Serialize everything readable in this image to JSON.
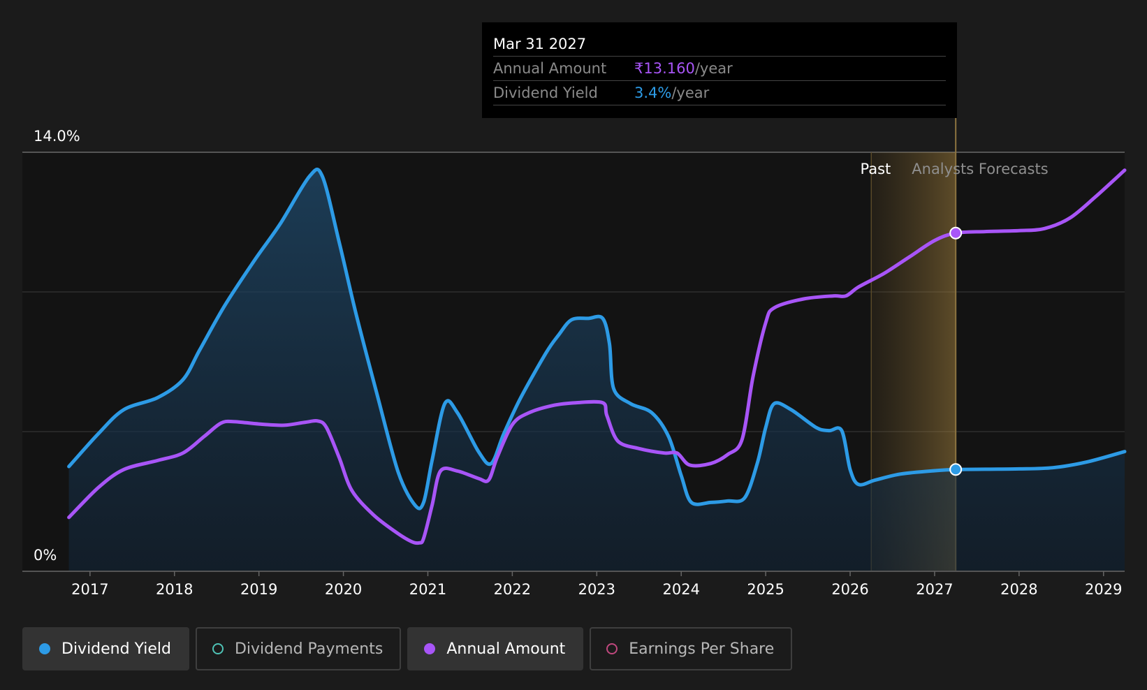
{
  "tooltip": {
    "date": "Mar 31 2027",
    "annual_amount_label": "Annual Amount",
    "annual_amount_value": "₹13.160",
    "annual_amount_unit": "/year",
    "dividend_yield_label": "Dividend Yield",
    "dividend_yield_value": "3.4%",
    "dividend_yield_unit": "/year"
  },
  "chart_data": {
    "type": "line",
    "y_axis_labels": {
      "top": "14.0%",
      "bottom": "0%"
    },
    "ylim": [
      0,
      14
    ],
    "xlim": [
      2016.72,
      2029.25
    ],
    "x_ticks": [
      2017,
      2018,
      2019,
      2020,
      2021,
      2022,
      2023,
      2024,
      2025,
      2026,
      2027,
      2028,
      2029
    ],
    "grid": true,
    "past_label": "Past",
    "forecast_label": "Analysts Forecasts",
    "forecast_start": 2026.25,
    "hover_date": 2027.25,
    "series": [
      {
        "name": "Dividend Yield",
        "color": "#2d9be6",
        "area_fill": true,
        "points": [
          [
            2016.75,
            3.5
          ],
          [
            2017.1,
            4.6
          ],
          [
            2017.4,
            5.4
          ],
          [
            2017.8,
            5.8
          ],
          [
            2018.1,
            6.4
          ],
          [
            2018.3,
            7.4
          ],
          [
            2018.6,
            8.9
          ],
          [
            2018.95,
            10.4
          ],
          [
            2019.25,
            11.6
          ],
          [
            2019.6,
            13.2
          ],
          [
            2019.75,
            13.2
          ],
          [
            2019.95,
            11.0
          ],
          [
            2020.15,
            8.6
          ],
          [
            2020.4,
            5.9
          ],
          [
            2020.65,
            3.3
          ],
          [
            2020.85,
            2.2
          ],
          [
            2020.95,
            2.3
          ],
          [
            2021.05,
            3.7
          ],
          [
            2021.2,
            5.6
          ],
          [
            2021.35,
            5.3
          ],
          [
            2021.6,
            4.0
          ],
          [
            2021.75,
            3.6
          ],
          [
            2021.9,
            4.6
          ],
          [
            2022.1,
            5.8
          ],
          [
            2022.4,
            7.3
          ],
          [
            2022.55,
            7.9
          ],
          [
            2022.7,
            8.4
          ],
          [
            2022.9,
            8.45
          ],
          [
            2023.07,
            8.45
          ],
          [
            2023.15,
            7.6
          ],
          [
            2023.2,
            6.1
          ],
          [
            2023.4,
            5.6
          ],
          [
            2023.65,
            5.3
          ],
          [
            2023.85,
            4.5
          ],
          [
            2024.0,
            3.2
          ],
          [
            2024.12,
            2.3
          ],
          [
            2024.35,
            2.3
          ],
          [
            2024.55,
            2.35
          ],
          [
            2024.75,
            2.45
          ],
          [
            2024.9,
            3.6
          ],
          [
            2025.0,
            4.8
          ],
          [
            2025.1,
            5.6
          ],
          [
            2025.3,
            5.4
          ],
          [
            2025.6,
            4.8
          ],
          [
            2025.75,
            4.7
          ],
          [
            2025.9,
            4.7
          ],
          [
            2026.0,
            3.4
          ],
          [
            2026.1,
            2.9
          ],
          [
            2026.3,
            3.05
          ],
          [
            2026.6,
            3.25
          ],
          [
            2027.0,
            3.36
          ],
          [
            2027.25,
            3.4
          ],
          [
            2027.6,
            3.41
          ],
          [
            2028.0,
            3.42
          ],
          [
            2028.4,
            3.46
          ],
          [
            2028.8,
            3.65
          ],
          [
            2029.25,
            4.0
          ]
        ]
      },
      {
        "name": "Annual Amount",
        "color": "#a855f7",
        "area_fill": false,
        "points": [
          [
            2016.75,
            1.8
          ],
          [
            2017.1,
            2.8
          ],
          [
            2017.4,
            3.4
          ],
          [
            2017.8,
            3.7
          ],
          [
            2018.1,
            3.95
          ],
          [
            2018.35,
            4.5
          ],
          [
            2018.55,
            4.95
          ],
          [
            2018.7,
            5.0
          ],
          [
            2019.0,
            4.92
          ],
          [
            2019.3,
            4.88
          ],
          [
            2019.55,
            4.98
          ],
          [
            2019.7,
            5.02
          ],
          [
            2019.8,
            4.8
          ],
          [
            2019.95,
            3.8
          ],
          [
            2020.1,
            2.7
          ],
          [
            2020.35,
            1.9
          ],
          [
            2020.6,
            1.35
          ],
          [
            2020.8,
            1.0
          ],
          [
            2020.9,
            0.95
          ],
          [
            2020.95,
            1.1
          ],
          [
            2021.05,
            2.2
          ],
          [
            2021.15,
            3.35
          ],
          [
            2021.35,
            3.35
          ],
          [
            2021.6,
            3.1
          ],
          [
            2021.72,
            3.05
          ],
          [
            2021.82,
            3.8
          ],
          [
            2022.0,
            4.9
          ],
          [
            2022.2,
            5.3
          ],
          [
            2022.5,
            5.55
          ],
          [
            2022.75,
            5.63
          ],
          [
            2023.07,
            5.63
          ],
          [
            2023.12,
            5.2
          ],
          [
            2023.25,
            4.35
          ],
          [
            2023.5,
            4.1
          ],
          [
            2023.8,
            3.95
          ],
          [
            2023.95,
            3.95
          ],
          [
            2024.1,
            3.55
          ],
          [
            2024.35,
            3.6
          ],
          [
            2024.55,
            3.9
          ],
          [
            2024.72,
            4.4
          ],
          [
            2024.85,
            6.5
          ],
          [
            2025.0,
            8.3
          ],
          [
            2025.1,
            8.8
          ],
          [
            2025.45,
            9.1
          ],
          [
            2025.8,
            9.2
          ],
          [
            2025.95,
            9.2
          ],
          [
            2026.1,
            9.5
          ],
          [
            2026.4,
            9.95
          ],
          [
            2026.7,
            10.5
          ],
          [
            2027.0,
            11.05
          ],
          [
            2027.25,
            11.3
          ],
          [
            2027.6,
            11.35
          ],
          [
            2028.0,
            11.38
          ],
          [
            2028.3,
            11.45
          ],
          [
            2028.6,
            11.8
          ],
          [
            2028.9,
            12.5
          ],
          [
            2029.25,
            13.4
          ]
        ]
      }
    ],
    "legend": [
      {
        "label": "Dividend Yield",
        "color": "#2d9be6",
        "filled": true,
        "active": true
      },
      {
        "label": "Dividend Payments",
        "color": "#4fc3b6",
        "filled": false,
        "active": false
      },
      {
        "label": "Annual Amount",
        "color": "#a855f7",
        "filled": true,
        "active": true
      },
      {
        "label": "Earnings Per Share",
        "color": "#c0487e",
        "filled": false,
        "active": false
      }
    ]
  }
}
